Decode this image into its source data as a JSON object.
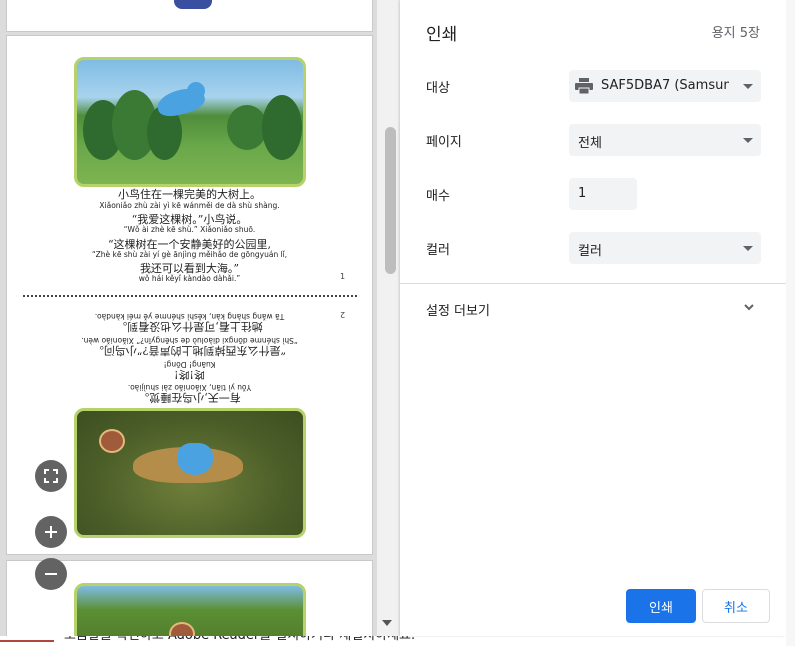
{
  "background_strip": {
    "text": "도움말을 확인하고 Adobe Reader를 설치하거나 재설치하세요."
  },
  "preview": {
    "page1": {
      "text_lines": [
        {
          "cn": "小鸟住在一棵完美的大树上。",
          "py": "Xiǎoniǎo zhù zài yì kē wánměi de dà shù shàng."
        },
        {
          "cn": "“我爱这棵树。”小鸟说。",
          "py": "“Wǒ ài zhè kē shù.” Xiǎoniǎo shuō."
        },
        {
          "cn": "“这棵树在一个安静美好的公园里,",
          "py": "“Zhè kē shù zài yí gè ānjìng měihǎo de gōngyuán lǐ,"
        },
        {
          "cn": "我还可以看到大海。”",
          "py": "wǒ hái kěyǐ kàndào dàhǎi.”"
        }
      ],
      "page_number": "1"
    },
    "page2": {
      "text_lines": [
        {
          "cn": "有一天,小鸟在睡觉。",
          "py": "Yǒu yì tiān, Xiǎoniǎo zài shuìjiào."
        },
        {
          "cn": "咚!咚!",
          "py": "Kuāng! Dōng!"
        },
        {
          "cn": "“是什么东西掉到地上的声音?”小鸟问。",
          "py": "“Shì shénme dōngxi diàoluò de shēngyīn?” Xiǎoniǎo wèn."
        },
        {
          "cn": "她往上看,可是什么也没看到。",
          "py": "Tā wǎng shàng kàn, kěshì shénme yě méi kàndào."
        }
      ],
      "page_number": "2"
    },
    "controls": {
      "fit_icon": "fit-to-page-icon",
      "zoom_in_icon": "plus-icon",
      "zoom_out_icon": "minus-icon"
    }
  },
  "print_panel": {
    "title": "인쇄",
    "sheet_count": "용지 5장",
    "destination": {
      "label": "대상",
      "value": "SAF5DBA7 (Samsung",
      "icon": "printer-icon"
    },
    "pages": {
      "label": "페이지",
      "value": "전체"
    },
    "copies": {
      "label": "매수",
      "value": "1"
    },
    "color": {
      "label": "컬러",
      "value": "컬러"
    },
    "more_settings": {
      "label": "설정 더보기"
    },
    "buttons": {
      "print": "인쇄",
      "cancel": "취소"
    },
    "accent_color": "#1a73e8"
  }
}
